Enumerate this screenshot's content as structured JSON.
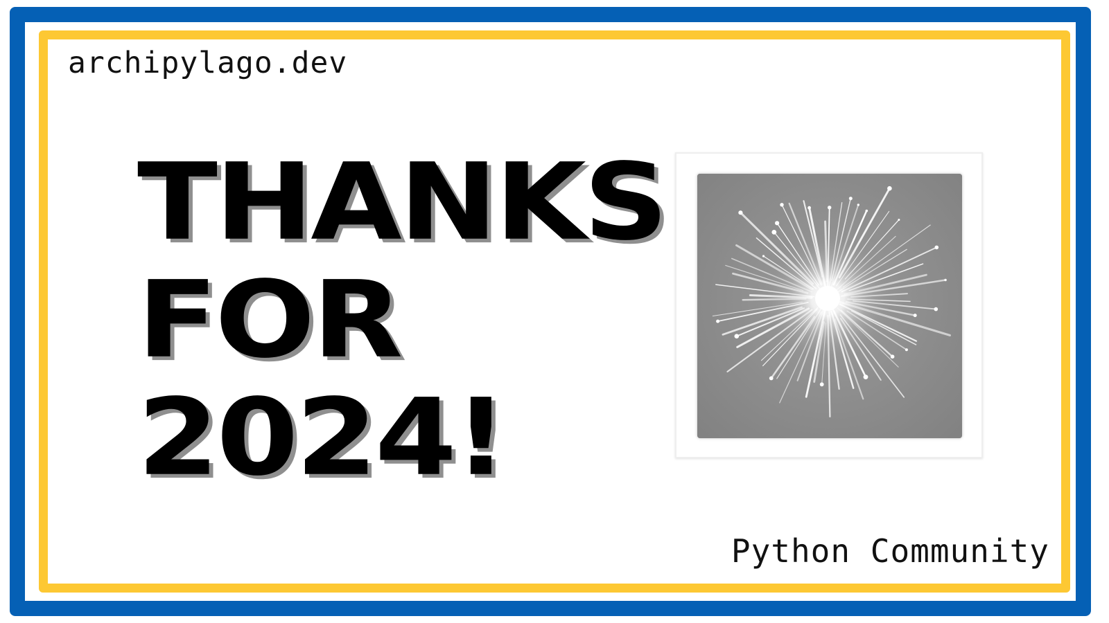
{
  "site": "archipylago.dev",
  "headline": {
    "line1": "THANKS",
    "line2": "FOR",
    "line3": "2024!"
  },
  "footer": "Python Community",
  "image": {
    "icon": "firework-burst-icon",
    "background_color": "#8A8A8A",
    "burst_color": "#FFFFFF"
  },
  "colors": {
    "outer_border": "#0560B5",
    "inner_border": "#FDC833",
    "text": "#000000",
    "text_shadow": "#8F8F8F",
    "background": "#FFFFFF"
  }
}
